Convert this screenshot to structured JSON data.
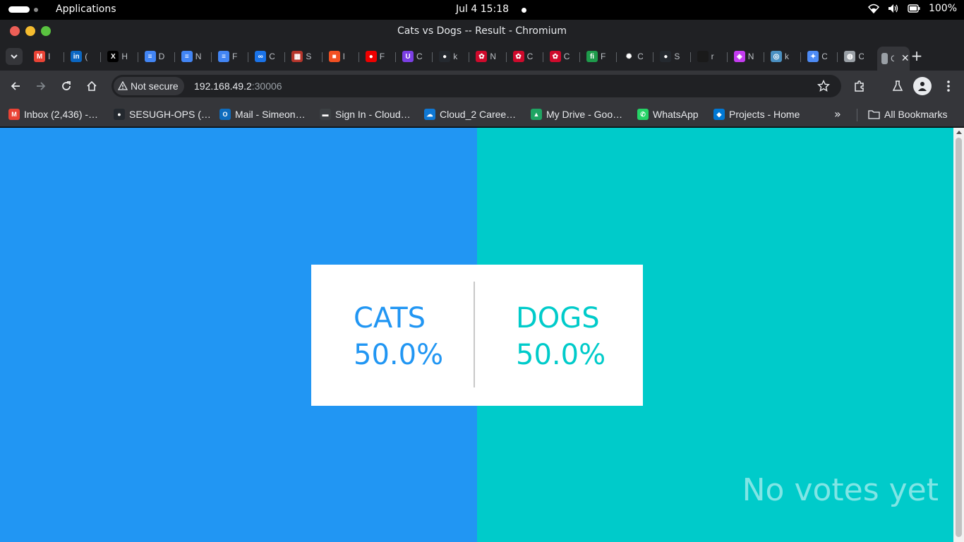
{
  "system": {
    "apps_label": "Applications",
    "clock": "Jul 4  15:18",
    "battery": "100%"
  },
  "window": {
    "title": "Cats vs Dogs -- Result - Chromium"
  },
  "tabs": [
    {
      "icon": "gmail-icon",
      "letter": "I",
      "color": "#ea4335"
    },
    {
      "icon": "linkedin-icon",
      "letter": "(",
      "color": "#0a66c2"
    },
    {
      "icon": "x-icon",
      "letter": "H",
      "color": "#000000"
    },
    {
      "icon": "google-docs-icon",
      "letter": "D",
      "color": "#4285f4"
    },
    {
      "icon": "google-docs-icon",
      "letter": "N",
      "color": "#4285f4"
    },
    {
      "icon": "google-docs-icon",
      "letter": "F",
      "color": "#4285f4"
    },
    {
      "icon": "link-icon",
      "letter": "C",
      "color": "#1a73e8"
    },
    {
      "icon": "calendar-icon",
      "letter": "S",
      "color": "#b5352b"
    },
    {
      "icon": "microsoft-icon",
      "letter": "I",
      "color": "#f25022"
    },
    {
      "icon": "redhat-icon",
      "letter": "F",
      "color": "#ee0000"
    },
    {
      "icon": "shield-icon",
      "letter": "C",
      "color": "#7b3fe4"
    },
    {
      "icon": "github-icon",
      "letter": "k",
      "color": "#24292f"
    },
    {
      "icon": "huawei-icon",
      "letter": "N",
      "color": "#cf0a2c"
    },
    {
      "icon": "huawei-icon",
      "letter": "C",
      "color": "#cf0a2c"
    },
    {
      "icon": "huawei-icon",
      "letter": "C",
      "color": "#cf0a2c"
    },
    {
      "icon": "fi-icon",
      "letter": "F",
      "color": "#1e9b4b"
    },
    {
      "icon": "openai-icon",
      "letter": "C",
      "color": "#202124"
    },
    {
      "icon": "github-icon",
      "letter": "S",
      "color": "#24292f"
    },
    {
      "icon": "dark-page-icon",
      "letter": "r",
      "color": "#1a1a1a"
    },
    {
      "icon": "cube-icon",
      "letter": "N",
      "color": "#c43cf0"
    },
    {
      "icon": "circle-logo-icon",
      "letter": "k",
      "color": "#4a90c2"
    },
    {
      "icon": "gemini-icon",
      "letter": "C",
      "color": "#4d8bf5"
    },
    {
      "icon": "globe-icon",
      "letter": "C",
      "color": "#9aa0a6"
    },
    {
      "icon": "active-tab-icon",
      "letter": "C",
      "color": "#9aa0a6"
    }
  ],
  "toolbar": {
    "security_label": "Not secure",
    "url_host": "192.168.49.2",
    "url_port": ":30006"
  },
  "bookmarks": [
    {
      "label": "Inbox (2,436) -…",
      "icon": "gmail-icon",
      "color": "#ea4335"
    },
    {
      "label": "SESUGH-OPS (…",
      "icon": "github-icon",
      "color": "#24292f"
    },
    {
      "label": "Mail - Simeon…",
      "icon": "outlook-icon",
      "color": "#0f6cbd"
    },
    {
      "label": "Sign In - Cloud…",
      "icon": "cloud-signin-icon",
      "color": "#3c4043"
    },
    {
      "label": "Cloud_2 Caree…",
      "icon": "onedrive-icon",
      "color": "#0f78d4"
    },
    {
      "label": "My Drive - Goo…",
      "icon": "google-drive-icon",
      "color": "#1fa463"
    },
    {
      "label": "WhatsApp",
      "icon": "whatsapp-icon",
      "color": "#25d366"
    },
    {
      "label": "Projects - Home",
      "icon": "azure-devops-icon",
      "color": "#0078d4"
    }
  ],
  "all_bookmarks_label": "All Bookmarks",
  "result_page": {
    "option_a": "CATS",
    "option_a_pct": "50.0%",
    "option_b": "DOGS",
    "option_b_pct": "50.0%",
    "status": "No votes yet",
    "colors": {
      "cats": "#2196f3",
      "dogs": "#00cbca"
    }
  }
}
